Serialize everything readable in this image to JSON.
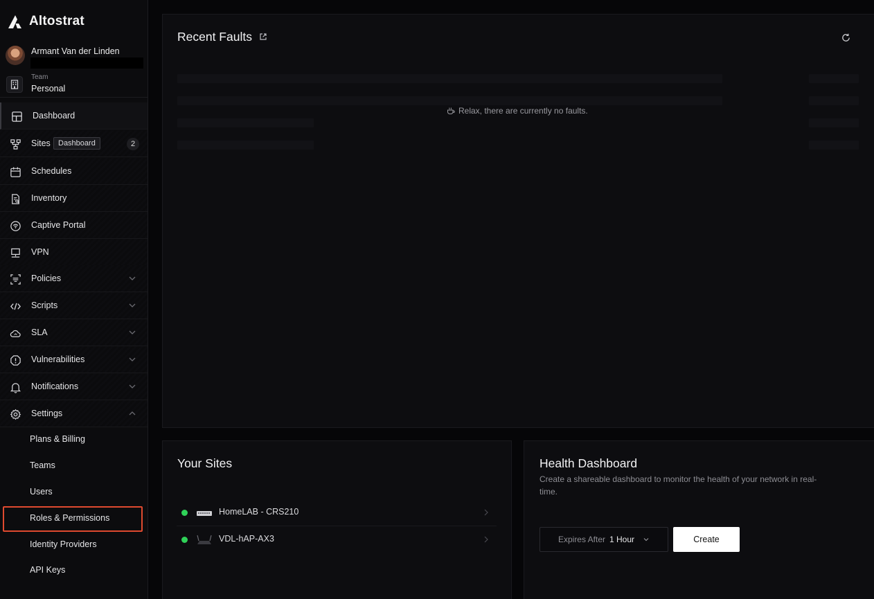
{
  "app": {
    "name": "Altostrat"
  },
  "user": {
    "name": "Armant Van der Linden"
  },
  "team": {
    "label": "Team",
    "name": "Personal"
  },
  "nav": {
    "dashboard": "Dashboard",
    "sites": "Sites",
    "sites_pill": "Dashboard",
    "sites_count": "2",
    "schedules": "Schedules",
    "inventory": "Inventory",
    "captive_portal": "Captive Portal",
    "vpn": "VPN",
    "policies": "Policies",
    "scripts": "Scripts",
    "sla": "SLA",
    "vulnerabilities": "Vulnerabilities",
    "notifications": "Notifications",
    "settings": "Settings"
  },
  "settings_sub": {
    "plans_billing": "Plans & Billing",
    "teams": "Teams",
    "users": "Users",
    "roles_permissions": "Roles & Permissions",
    "identity_providers": "Identity Providers",
    "api_keys": "API Keys"
  },
  "faults": {
    "title": "Recent Faults",
    "empty_message": "Relax, there are currently no faults."
  },
  "sites_panel": {
    "title": "Your Sites",
    "sites": [
      {
        "name": "HomeLAB - CRS210",
        "status": "online",
        "device_icon": "switch-icon"
      },
      {
        "name": "VDL-hAP-AX3",
        "status": "online",
        "device_icon": "router-icon"
      }
    ]
  },
  "health": {
    "title": "Health Dashboard",
    "description": "Create a shareable dashboard to monitor the health of your network in real-time.",
    "expires_label": "Expires After",
    "expires_value": "1 Hour",
    "create_label": "Create"
  },
  "colors": {
    "status_online": "#2fd158",
    "highlight": "#e04a2f",
    "primary_button": "#ffffff"
  }
}
